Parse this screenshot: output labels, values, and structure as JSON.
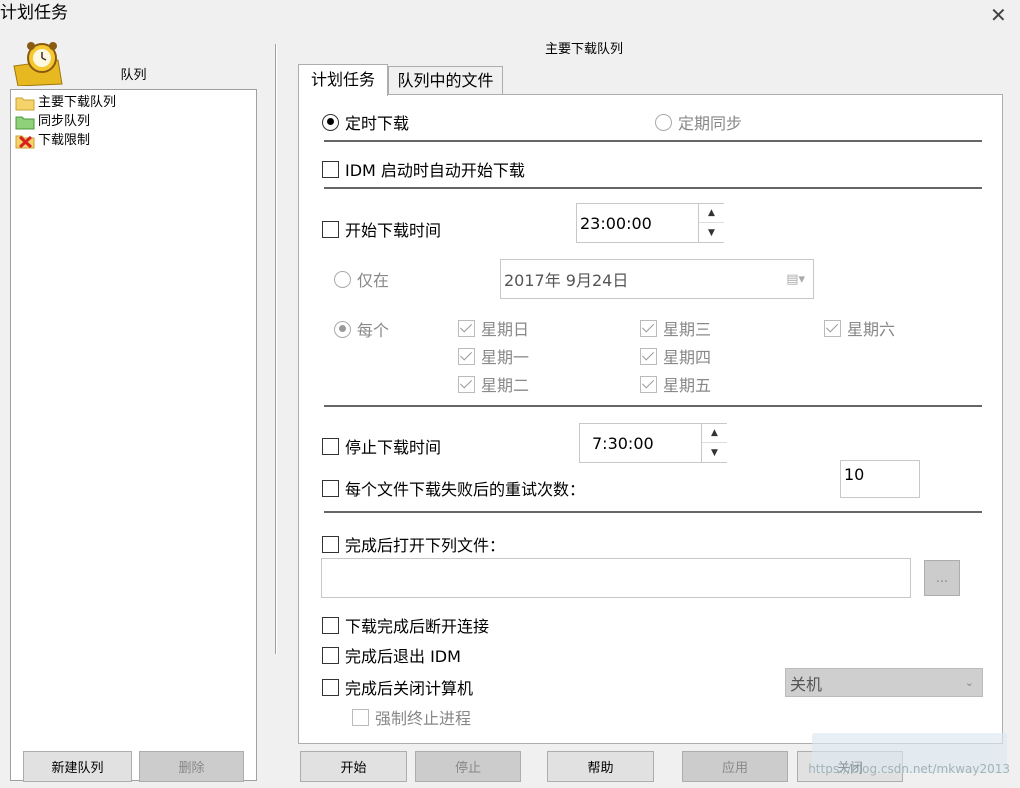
{
  "window": {
    "title": "计划任务",
    "close_glyph": "✕"
  },
  "left": {
    "header": "队列",
    "queues": [
      {
        "label": "主要下载队列",
        "icon": "folder-yellow-icon"
      },
      {
        "label": "同步队列",
        "icon": "folder-green-icon"
      },
      {
        "label": "下载限制",
        "icon": "folder-red-x-icon"
      }
    ]
  },
  "panel_title": "主要下载队列",
  "tabs": [
    "计划任务",
    "队列中的文件"
  ],
  "mode": {
    "scheduled": "定时下载",
    "sync": "定期同步"
  },
  "idm_autostart": "IDM 启动时自动开始下载",
  "start": {
    "label": "开始下载时间",
    "time": "23:00:00",
    "only_on": "仅在",
    "date": "2017年  9月24日",
    "every": "每个",
    "days": [
      "星期日",
      "星期一",
      "星期二",
      "星期三",
      "星期四",
      "星期五",
      "星期六"
    ]
  },
  "stop": {
    "label": "停止下载时间",
    "time": "7:30:00"
  },
  "retry": {
    "label": "每个文件下载失败后的重试次数：",
    "value": "10"
  },
  "open_file": {
    "label": "完成后打开下列文件：",
    "value": "",
    "browse": "..."
  },
  "after": {
    "hangup": "下载完成后断开连接",
    "exit_idm": "完成后退出 IDM",
    "shutdown": "完成后关闭计算机",
    "shutdown_option": "关机",
    "force": "强制终止进程"
  },
  "buttons": {
    "new_queue": "新建队列",
    "delete": "删除",
    "start": "开始",
    "stop": "停止",
    "help": "帮助",
    "apply": "应用",
    "close": "关闭"
  },
  "watermark": "https://blog.csdn.net/mkway2013"
}
